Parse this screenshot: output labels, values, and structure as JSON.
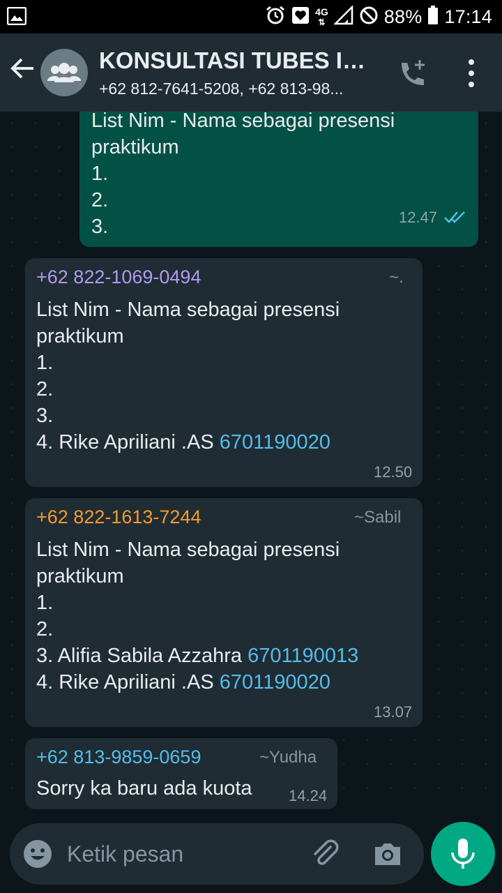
{
  "status_bar": {
    "network": "4G",
    "battery": "88%",
    "time": "17:14"
  },
  "header": {
    "title": "KONSULTASI TUBES ID...",
    "subtitle": "+62 812-7641-5208, +62 813-98..."
  },
  "messages": [
    {
      "type": "outgoing",
      "text": "List Nim - Nama sebagai presensi\npraktikum\n1.\n2.\n3.",
      "time": "12.47",
      "status": "read"
    },
    {
      "type": "incoming",
      "sender": "+62 822-1069-0494",
      "sender_color": "#b09af2",
      "alias": "~.",
      "lines": [
        "List Nim - Nama sebagai presensi",
        "praktikum",
        "1.",
        "2.",
        "3."
      ],
      "name_line": "4. Rike Apriliani .AS ",
      "nim": "6701190020",
      "time": "12.50"
    },
    {
      "type": "incoming",
      "sender": "+62 822-1613-7244",
      "sender_color": "#f79a2b",
      "alias": "~Sabil",
      "lines": [
        "List Nim - Nama sebagai presensi",
        "praktikum",
        "1.",
        "2."
      ],
      "name_line_1": "3. Alifia Sabila Azzahra ",
      "nim_1": "6701190013",
      "name_line_2": "4. Rike Apriliani .AS ",
      "nim_2": "6701190020",
      "time": "13.07"
    },
    {
      "type": "incoming",
      "sender": "+62 813-9859-0659",
      "sender_color": "#53bdeb",
      "alias": "~Yudha",
      "text": "Sorry ka baru ada kuota",
      "time": "14.24"
    }
  ],
  "input": {
    "placeholder": "Ketik pesan"
  },
  "colors": {
    "header_bg": "#1f2c33",
    "outgoing_bubble": "#025144",
    "incoming_bubble": "#1f2c33",
    "link": "#53bdeb",
    "mic_button": "#00a884"
  }
}
